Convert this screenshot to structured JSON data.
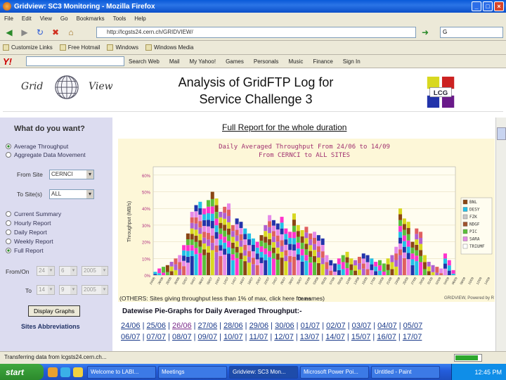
{
  "window": {
    "title": "Gridview: SC3 Monitoring - Mozilla Firefox"
  },
  "menu": [
    "File",
    "Edit",
    "View",
    "Go",
    "Bookmarks",
    "Tools",
    "Help"
  ],
  "nav": {
    "url": "http://lcgsts24.cern.ch/GRIDVIEW/",
    "search_value": "G"
  },
  "bookmarks": [
    "Customize Links",
    "Free Hotmail",
    "Windows",
    "Windows Media"
  ],
  "yahoo": {
    "logo": "Y!",
    "items": [
      "Search Web",
      "Mail",
      "My Yahoo!",
      "Games",
      "Personals",
      "Music",
      "Finance",
      "Sign In"
    ]
  },
  "header": {
    "logo_grid": "Grid",
    "logo_view": "View",
    "title_line1": "Analysis of GridFTP Log for",
    "title_line2": "Service Challenge 3",
    "lcg_label": "LCG"
  },
  "sidebar": {
    "heading": "What do you want?",
    "opt_avg": "Average Throughput",
    "opt_agg": "Aggregate Data Movement",
    "from_label": "From Site",
    "from_value": "CERNCI",
    "to_label": "To Site(s)",
    "to_value": "ALL",
    "opt_current": "Current Summary",
    "opt_hourly": "Hourly Report",
    "opt_daily": "Daily Report",
    "opt_weekly": "Weekly Report",
    "opt_full": "Full Report",
    "from_date_label": "From/On",
    "from_day": "24",
    "from_month": "6",
    "from_year": "2005",
    "to_date_label": "To",
    "to_day": "14",
    "to_month": "9",
    "to_year": "2005",
    "display_button": "Display Graphs",
    "abbr_link": "Sites Abbreviations"
  },
  "main": {
    "report_title": "Full Report for the whole duration",
    "others_note": "(OTHERS: Sites giving throughput less than 1% of max, click here for names)",
    "pie_heading": "Datewise Pie-Graphs for Daily Averaged Throughput:-",
    "dates_row1": [
      "24/06",
      "25/06",
      "26/06",
      "27/06",
      "28/06",
      "29/06",
      "30/06",
      "01/07",
      "02/07",
      "03/07",
      "04/07",
      "05/07"
    ],
    "dates_row2": [
      "06/07",
      "07/07",
      "08/07",
      "09/07",
      "10/07",
      "11/07",
      "12/07",
      "13/07",
      "14/07",
      "15/07",
      "16/07",
      "17/07"
    ]
  },
  "chart_data": {
    "type": "bar",
    "stacked": true,
    "title": "Daily Averaged Throughput From 24/06 to 14/09",
    "subtitle": "From CERNCI to ALL SITES",
    "xlabel": "Dates",
    "ylabel": "Throughput (MB/s)",
    "yticks": [
      "0",
      "10",
      "20",
      "30",
      "40",
      "50",
      "60"
    ],
    "ylim": [
      0,
      65
    ],
    "footer": "GRIDVIEW, Powered by R",
    "legend_position": "right",
    "legend": [
      {
        "name": "BNL",
        "color": "#8b4513"
      },
      {
        "name": "DESY",
        "color": "#22c0e8"
      },
      {
        "name": "FZK",
        "color": "#c8c8c8"
      },
      {
        "name": "NDGF",
        "color": "#a0522d"
      },
      {
        "name": "PIC",
        "color": "#5abf3a"
      },
      {
        "name": "SARA",
        "color": "#e68ae8"
      },
      {
        "name": "TRIUMF",
        "color": "#ffffff"
      }
    ],
    "series_colors": [
      "#2233aa",
      "#22c0e8",
      "#ff33cc",
      "#5abf3a",
      "#8b4513",
      "#d8d820",
      "#b060d0",
      "#e06060",
      "#e68ae8"
    ],
    "totals": [
      2,
      4,
      5,
      6,
      8,
      10,
      12,
      18,
      25,
      38,
      42,
      44,
      40,
      45,
      50,
      46,
      38,
      41,
      43,
      30,
      34,
      32,
      28,
      25,
      22,
      20,
      24,
      30,
      36,
      33,
      31,
      35,
      28,
      26,
      37,
      30,
      27,
      29,
      25,
      26,
      24,
      22,
      12,
      9,
      7,
      10,
      12,
      14,
      10,
      9,
      11,
      13,
      12,
      10,
      8,
      9,
      7,
      10,
      12,
      17,
      40,
      34,
      32,
      20,
      28,
      26,
      12,
      8,
      6,
      5,
      4,
      13,
      9,
      3
    ],
    "xtick_labels": [
      "24/06",
      "26/06",
      "28/06",
      "30/06",
      "02/07",
      "04/07",
      "06/07",
      "08/07",
      "10/07",
      "12/07",
      "14/07",
      "16/07",
      "18/07",
      "20/07",
      "22/07",
      "24/07",
      "26/07",
      "28/07",
      "30/07",
      "01/08",
      "03/08",
      "05/08",
      "07/08",
      "09/08",
      "11/08",
      "13/08",
      "15/08",
      "17/08",
      "19/08",
      "21/08",
      "23/08",
      "25/08",
      "27/08",
      "29/08",
      "31/08",
      "02/09",
      "04/09",
      "06/09",
      "08/09",
      "10/09",
      "12/09",
      "14/09"
    ]
  },
  "status": {
    "text": "Transferring data from lcgsts24.cern.ch..."
  },
  "taskbar": {
    "start": "start",
    "tasks": [
      "Welcome to LABI...",
      "Meetings",
      "Gridview: SC3 Mon...",
      "Microsoft Power Poi...",
      "Untitled - Paint"
    ],
    "clock": "12:45 PM"
  }
}
